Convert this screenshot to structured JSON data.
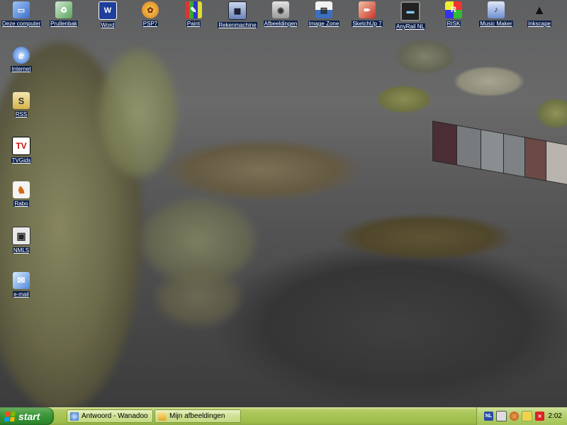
{
  "desktop": {
    "top_icons": [
      {
        "label": "Deze computer",
        "icon": "computer-icon"
      },
      {
        "label": "Prullenbak",
        "icon": "recycle-bin-icon"
      },
      {
        "label": "Word",
        "icon": "word-icon"
      },
      {
        "label": "PSP7",
        "icon": "psp-icon"
      },
      {
        "label": "Paint",
        "icon": "paint-icon"
      },
      {
        "label": "Rekenmachine",
        "icon": "calculator-icon"
      },
      {
        "label": "Afbeeldingen",
        "icon": "camera-icon"
      },
      {
        "label": "Image Zone",
        "icon": "image-zone-icon"
      },
      {
        "label": "SketchUp 7",
        "icon": "sketchup-icon"
      },
      {
        "label": "AnyRail NL",
        "icon": "monitor-icon"
      },
      {
        "label": "RISK",
        "icon": "risk-icon"
      },
      {
        "label": "Music Maker",
        "icon": "music-maker-icon"
      },
      {
        "label": "Inkscape",
        "icon": "inkscape-icon"
      }
    ],
    "left_icons": [
      {
        "label": "Internet",
        "icon": "internet-explorer-icon",
        "glyph": "e"
      },
      {
        "label": "RSS",
        "icon": "rss-icon",
        "glyph": "S"
      },
      {
        "label": "TVGids",
        "icon": "tv-guide-icon",
        "glyph": "TV"
      },
      {
        "label": "Rabo",
        "icon": "rabo-icon",
        "glyph": "♞"
      },
      {
        "label": "NMLS",
        "icon": "nmls-icon",
        "glyph": "▣"
      },
      {
        "label": "e-mail",
        "icon": "email-icon",
        "glyph": "✉"
      }
    ]
  },
  "taskbar": {
    "start_label": "start",
    "tasks": [
      {
        "label": "Antwoord - Wanadoo",
        "icon": "ie-window-icon"
      },
      {
        "label": "Mijn afbeeldingen",
        "icon": "folder-icon"
      }
    ],
    "tray": {
      "language": "NL",
      "clock": "2:02"
    }
  },
  "colors": {
    "taskbar": "#a6c455",
    "start_button": "#3f9a3c",
    "icon_label_bg": "#0b1f4a"
  }
}
